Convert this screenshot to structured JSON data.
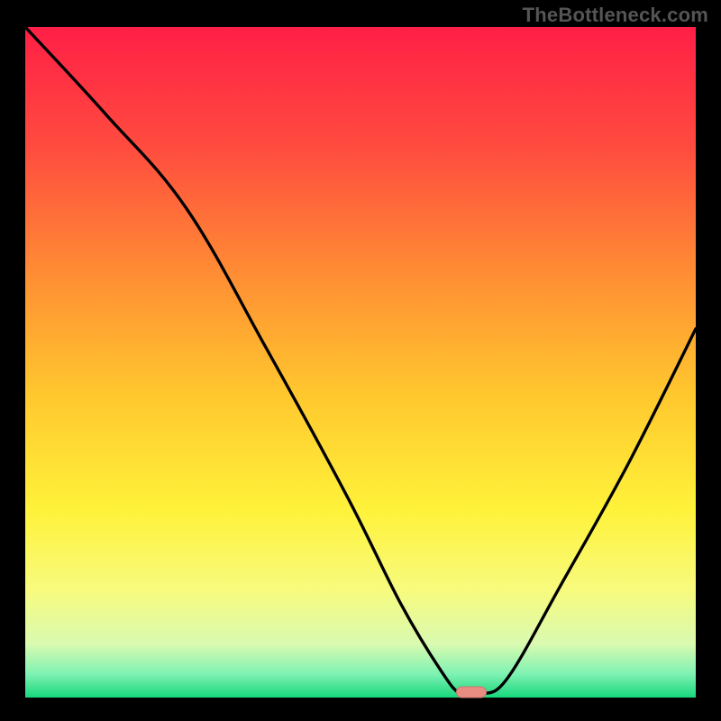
{
  "watermark": "TheBottleneck.com",
  "chart_data": {
    "type": "line",
    "title": "",
    "xlabel": "",
    "ylabel": "",
    "xlim": [
      0,
      100
    ],
    "ylim": [
      0,
      100
    ],
    "grid": false,
    "series": [
      {
        "name": "curve",
        "x": [
          0,
          12,
          24,
          36,
          48,
          56,
          62,
          65,
          68,
          72,
          80,
          90,
          100
        ],
        "y": [
          100,
          87,
          73,
          52,
          30,
          14,
          4,
          0.5,
          0.5,
          3,
          17,
          35,
          55
        ]
      }
    ],
    "marker": {
      "x": 66.5,
      "y": 0.5,
      "color": "#E98D83"
    },
    "gradient_stops": [
      {
        "offset": 0,
        "color": "#FF1F46"
      },
      {
        "offset": 18,
        "color": "#FF4C3F"
      },
      {
        "offset": 38,
        "color": "#FF9133"
      },
      {
        "offset": 55,
        "color": "#FFC82E"
      },
      {
        "offset": 72,
        "color": "#FFF23A"
      },
      {
        "offset": 84,
        "color": "#F7FB7E"
      },
      {
        "offset": 92,
        "color": "#D9FAB0"
      },
      {
        "offset": 96.5,
        "color": "#7EF2B2"
      },
      {
        "offset": 100,
        "color": "#17D87C"
      }
    ]
  }
}
